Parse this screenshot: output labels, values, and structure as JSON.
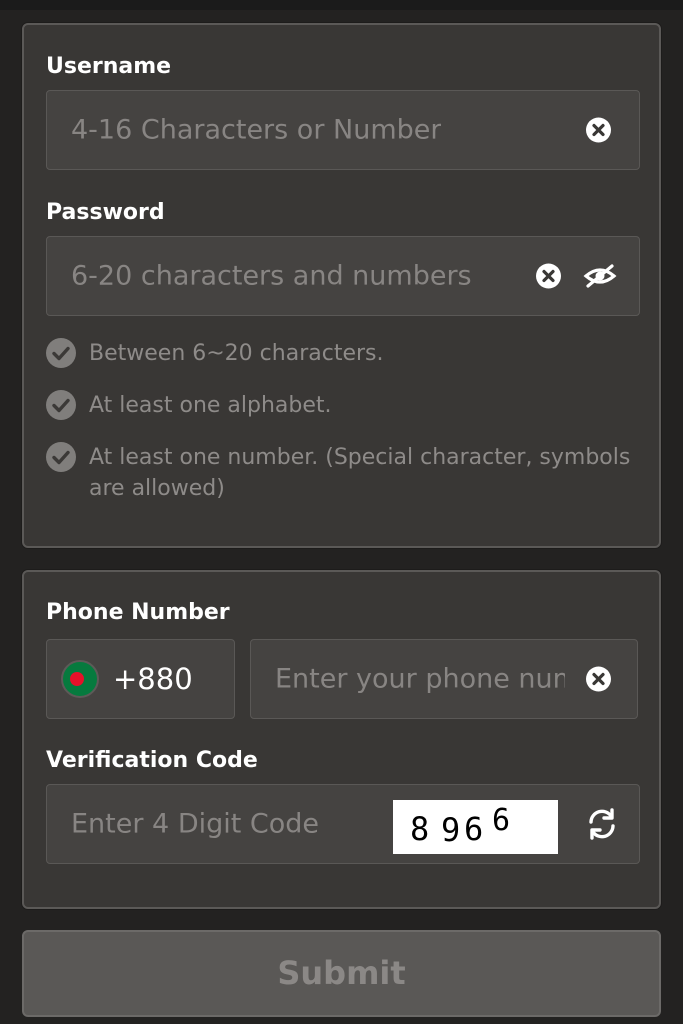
{
  "username": {
    "label": "Username",
    "placeholder": "4-16 Characters or Number"
  },
  "password": {
    "label": "Password",
    "placeholder": "6-20 characters and numbers",
    "rules": [
      "Between 6~20 characters.",
      "At least one alphabet.",
      "At least one number. (Special character, symbols are allowed)"
    ]
  },
  "phone": {
    "label": "Phone Number",
    "country_code": "+880",
    "placeholder": "Enter your phone number"
  },
  "verification": {
    "label": "Verification Code",
    "placeholder": "Enter 4 Digit Code",
    "captcha_digits": [
      "8",
      "9",
      "6",
      "6"
    ]
  },
  "submit_label": "Submit",
  "icons": {
    "clear": "clear-circle-icon",
    "visibility": "eye-slash-icon",
    "check": "check-circle-icon",
    "flag": "bangladesh-flag-icon",
    "refresh": "refresh-icon"
  },
  "colors": {
    "background": "#232221",
    "card": "#393735",
    "field": "#454341",
    "placeholder": "#888583",
    "flag_green": "#067a3e",
    "flag_red": "#e7112a"
  }
}
